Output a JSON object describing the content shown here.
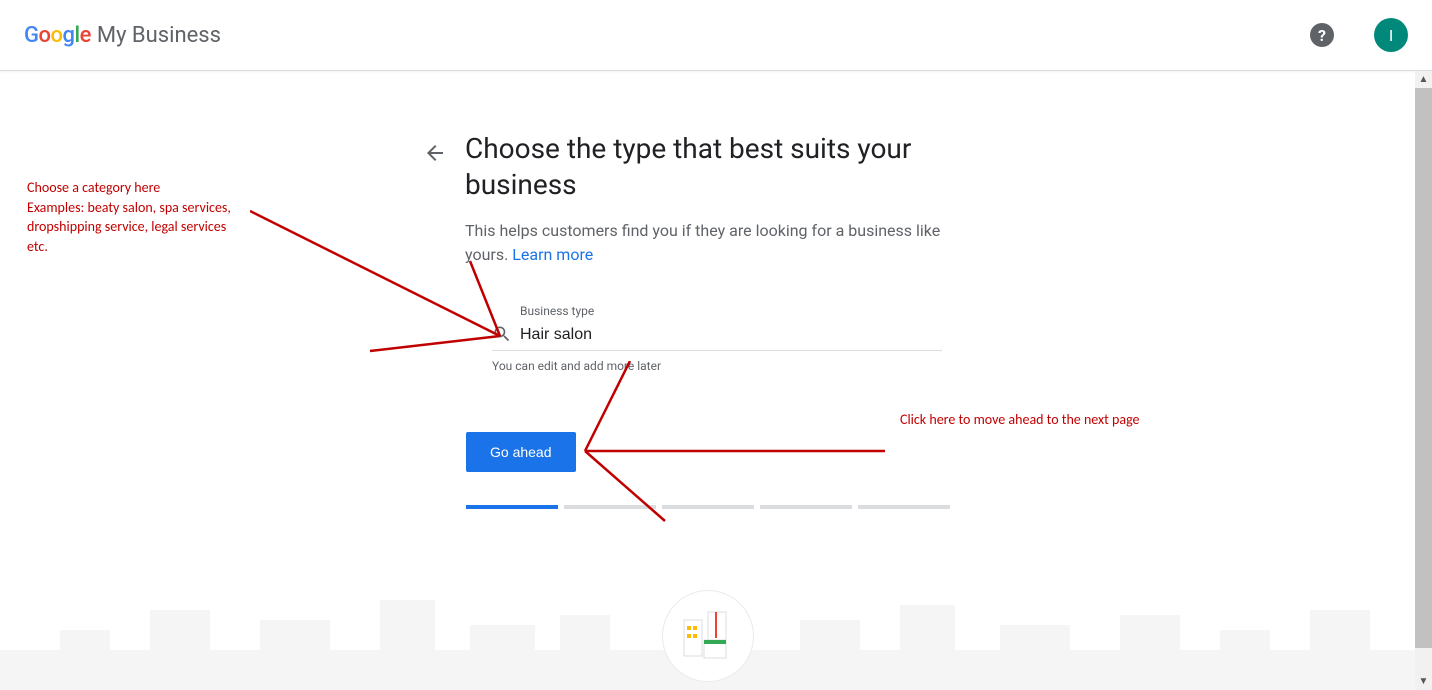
{
  "header": {
    "logo_google": "Google",
    "product_name": "My Business",
    "help_glyph": "?",
    "avatar_letter": "I"
  },
  "page": {
    "title": "Choose the type that best suits your business",
    "subtitle_part1": "This helps customers find you if they are looking for a business like yours. ",
    "learn_more": "Learn more",
    "input_label": "Business type",
    "input_value": "Hair salon",
    "input_hint": "You can edit and add more later",
    "button_label": "Go ahead",
    "progress_total": 5,
    "progress_active": 1
  },
  "annotations": {
    "left_text": "Choose a category here\nExamples: beaty salon, spa services, dropshipping service, legal services etc.",
    "right_text": "Click here to move ahead to the next page"
  }
}
